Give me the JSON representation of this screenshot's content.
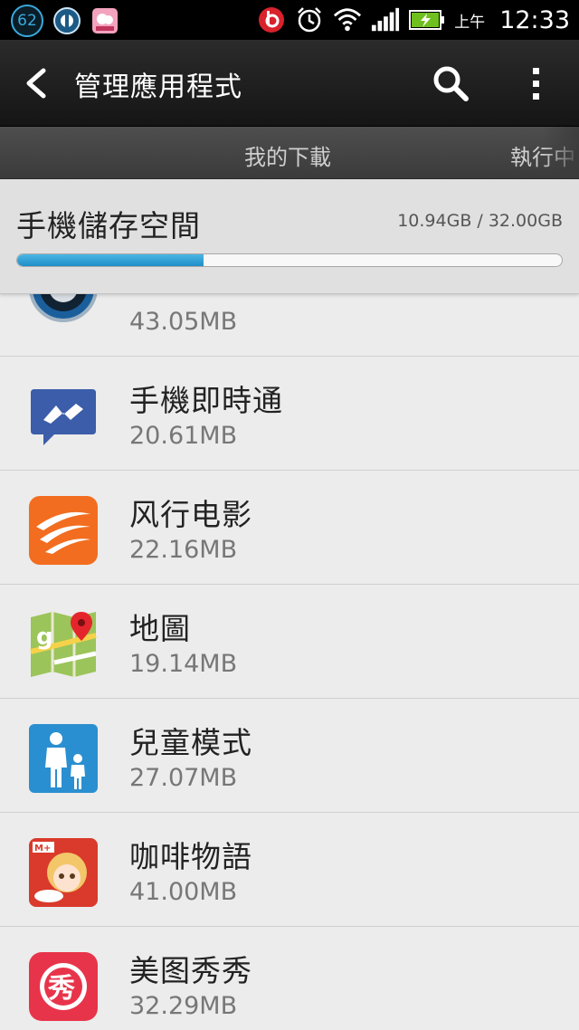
{
  "status_bar": {
    "badge_count": "62",
    "ampm": "上午",
    "time": "12:33",
    "icons": [
      "badge-62-icon",
      "ttpod-notification-icon",
      "pink-app-icon",
      "beats-audio-icon",
      "alarm-icon",
      "wifi-icon",
      "signal-icon",
      "battery-charging-icon"
    ]
  },
  "action_bar": {
    "title": "管理應用程式",
    "icons": [
      "back-icon",
      "search-icon",
      "overflow-menu-icon"
    ]
  },
  "tabs": [
    "我的下載",
    "執行中"
  ],
  "storage": {
    "title": "手機儲存空間",
    "amount": "10.94GB / 32.00GB",
    "used_fraction": 0.342,
    "accent": "#2a9ad3"
  },
  "apps": [
    {
      "name": "",
      "size": "43.05MB",
      "icon": "ttpod-app-icon"
    },
    {
      "name": "手機即時通",
      "size": "20.61MB",
      "icon": "messenger-app-icon"
    },
    {
      "name": "风行电影",
      "size": "22.16MB",
      "icon": "funshion-app-icon"
    },
    {
      "name": "地圖",
      "size": "19.14MB",
      "icon": "maps-app-icon"
    },
    {
      "name": "兒童模式",
      "size": "27.07MB",
      "icon": "kids-mode-app-icon"
    },
    {
      "name": "咖啡物語",
      "size": "41.00MB",
      "icon": "cafe-story-app-icon"
    },
    {
      "name": "美图秀秀",
      "size": "32.29MB",
      "icon": "meitu-app-icon"
    }
  ]
}
